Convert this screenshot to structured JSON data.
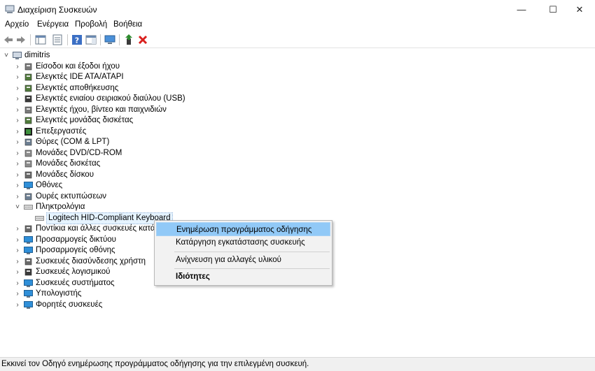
{
  "window": {
    "title": "Διαχείριση Συσκευών",
    "minimize": "—",
    "maximize": "☐",
    "close": "✕"
  },
  "menu": [
    "Αρχείο",
    "Ενέργεια",
    "Προβολή",
    "Βοήθεια"
  ],
  "toolbar": {
    "buttons": [
      "back-arrow",
      "forward-arrow",
      "show-hide-console-tree",
      "properties",
      "help",
      "show-action-pane",
      "scan-hardware",
      "update-driver",
      "uninstall-device"
    ]
  },
  "tree": {
    "root": "dimitris",
    "categories": [
      {
        "label": "Είσοδοι και έξοδοι ήχου",
        "icon": "speaker-icon"
      },
      {
        "label": "Ελεγκτές IDE ATA/ATAPI",
        "icon": "ide-controller-icon"
      },
      {
        "label": "Ελεγκτές αποθήκευσης",
        "icon": "storage-controller-icon"
      },
      {
        "label": "Ελεγκτές ενιαίου σειριακού διαύλου (USB)",
        "icon": "usb-icon"
      },
      {
        "label": "Ελεγκτές ήχου, βίντεο και παιχνιδιών",
        "icon": "sound-video-icon"
      },
      {
        "label": "Ελεγκτές μονάδας δισκέτας",
        "icon": "floppy-controller-icon"
      },
      {
        "label": "Επεξεργαστές",
        "icon": "processor-icon"
      },
      {
        "label": "Θύρες (COM & LPT)",
        "icon": "port-icon"
      },
      {
        "label": "Μονάδες DVD/CD-ROM",
        "icon": "dvd-drive-icon"
      },
      {
        "label": "Μονάδες δισκέτας",
        "icon": "floppy-drive-icon"
      },
      {
        "label": "Μονάδες δίσκου",
        "icon": "disk-drive-icon"
      },
      {
        "label": "Οθόνες",
        "icon": "monitor-icon"
      },
      {
        "label": "Ουρές εκτυπώσεων",
        "icon": "print-queue-icon"
      },
      {
        "label": "Πληκτρολόγια",
        "icon": "keyboard-icon",
        "expanded": true,
        "children": [
          {
            "label": "Logitech HID-Compliant Keyboard",
            "icon": "keyboard-icon"
          }
        ]
      },
      {
        "label": "Ποντίκια και άλλες συσκευές κατάδειξης",
        "icon": "mouse-icon"
      },
      {
        "label": "Προσαρμογείς δικτύου",
        "icon": "network-adapter-icon"
      },
      {
        "label": "Προσαρμογείς οθόνης",
        "icon": "display-adapter-icon"
      },
      {
        "label": "Συσκευές διασύνδεσης χρήστη",
        "icon": "hid-icon"
      },
      {
        "label": "Συσκευές λογισμικού",
        "icon": "software-device-icon"
      },
      {
        "label": "Συσκευές συστήματος",
        "icon": "system-device-icon"
      },
      {
        "label": "Υπολογιστής",
        "icon": "computer-icon"
      },
      {
        "label": "Φορητές συσκευές",
        "icon": "portable-device-icon"
      }
    ]
  },
  "context_menu": {
    "update_driver": "Ενημέρωση προγράμματος οδήγησης",
    "uninstall": "Κατάργηση εγκατάστασης συσκευής",
    "scan": "Ανίχνευση για αλλαγές υλικού",
    "properties": "Ιδιότητες"
  },
  "status": "Εκκινεί τον Οδηγό ενημέρωσης προγράμματος οδήγησης για την επιλεγμένη συσκευή.",
  "colors": {
    "accent": "#91c9f7",
    "delete_red": "#d9201e",
    "green": "#2e8b2e"
  }
}
